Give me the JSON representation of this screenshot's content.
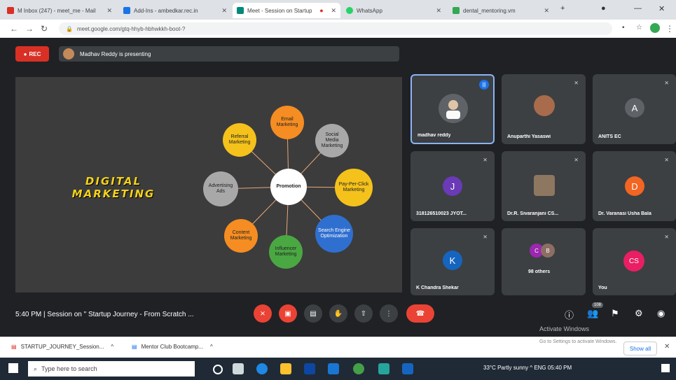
{
  "browser": {
    "tabs": [
      {
        "label": "M Inbox (247) - meet_me - Mail",
        "color": "#d93025"
      },
      {
        "label": "Add-Ins - ambedkar.rec.in",
        "color": "#1a73e8"
      },
      {
        "label": "Meet - Session on Startup",
        "color": "#00897b"
      },
      {
        "label": "WhatsApp",
        "color": "#25d366"
      },
      {
        "label": "dental_mentoring.vm",
        "color": "#34a853"
      }
    ],
    "new_tab": "+",
    "address": "meet.google.com/gtq-hhyb-hbhwkkh-boot-?"
  },
  "meet": {
    "rec_label": "REC",
    "presenting_label": "Madhav Reddy is presenting",
    "slide": {
      "title_line1": "DIGITAL",
      "title_line2": "MARKETING",
      "center": "Promotion",
      "nodes": [
        {
          "label": "Email Marketing",
          "color": "#f58d22"
        },
        {
          "label": "Social Media Marketing",
          "color": "#a8a8a8"
        },
        {
          "label": "Pay-Per-Click Marketing",
          "color": "#f4c21b"
        },
        {
          "label": "Search Engine Optimization",
          "color": "#2f6fd0"
        },
        {
          "label": "Influencer Marketing",
          "color": "#4aa842"
        },
        {
          "label": "Content Marketing",
          "color": "#f58d22"
        },
        {
          "label": "Advertising Ads",
          "color": "#a8a8a8"
        },
        {
          "label": "Referral Marketing",
          "color": "#f4c21b"
        }
      ]
    },
    "participants": [
      {
        "name": "madhav reddy",
        "avatar": "",
        "avatar_color": "#5f6368",
        "active": true
      },
      {
        "name": "Anuparthi Yasaswi",
        "avatar": "",
        "avatar_color": "#a86b4c",
        "active": false
      },
      {
        "name": "ANITS EC",
        "avatar": "A",
        "avatar_color": "#5f6368",
        "active": false
      },
      {
        "name": "318126510023 JYOT...",
        "avatar": "J",
        "avatar_color": "#6a3ab7",
        "active": false
      },
      {
        "name": "Dr.R. Sivaranjani CS...",
        "avatar": "",
        "avatar_color": "#8d7760",
        "active": false
      },
      {
        "name": "Dr. Varanasi Usha Bala",
        "avatar": "D",
        "avatar_color": "#f26522",
        "active": false
      },
      {
        "name": "K Chandra Shekar",
        "avatar": "K",
        "avatar_color": "#1565c0",
        "active": false
      },
      {
        "name": "98 others",
        "avatar": "",
        "avatar_color": "#9c27b0",
        "active": false
      },
      {
        "name": "You",
        "avatar": "CS",
        "avatar_color": "#e91e63",
        "active": false
      }
    ],
    "bottom": {
      "time_session": "5:40 PM  |  Session on \" Startup Journey - From Scratch ...",
      "people_count": "108",
      "activate_windows": "Activate Windows"
    }
  },
  "downloads": {
    "items": [
      "STARTUP_JOURNEY_Session...",
      "Mentor Club Bootcamp..."
    ],
    "show_all": "Show all",
    "settings_hint": "Go to Settings to activate Windows."
  },
  "taskbar": {
    "search_placeholder": "Type here to search",
    "tray": "33°C  Partly sunny  ^  ENG  05:40 PM"
  }
}
